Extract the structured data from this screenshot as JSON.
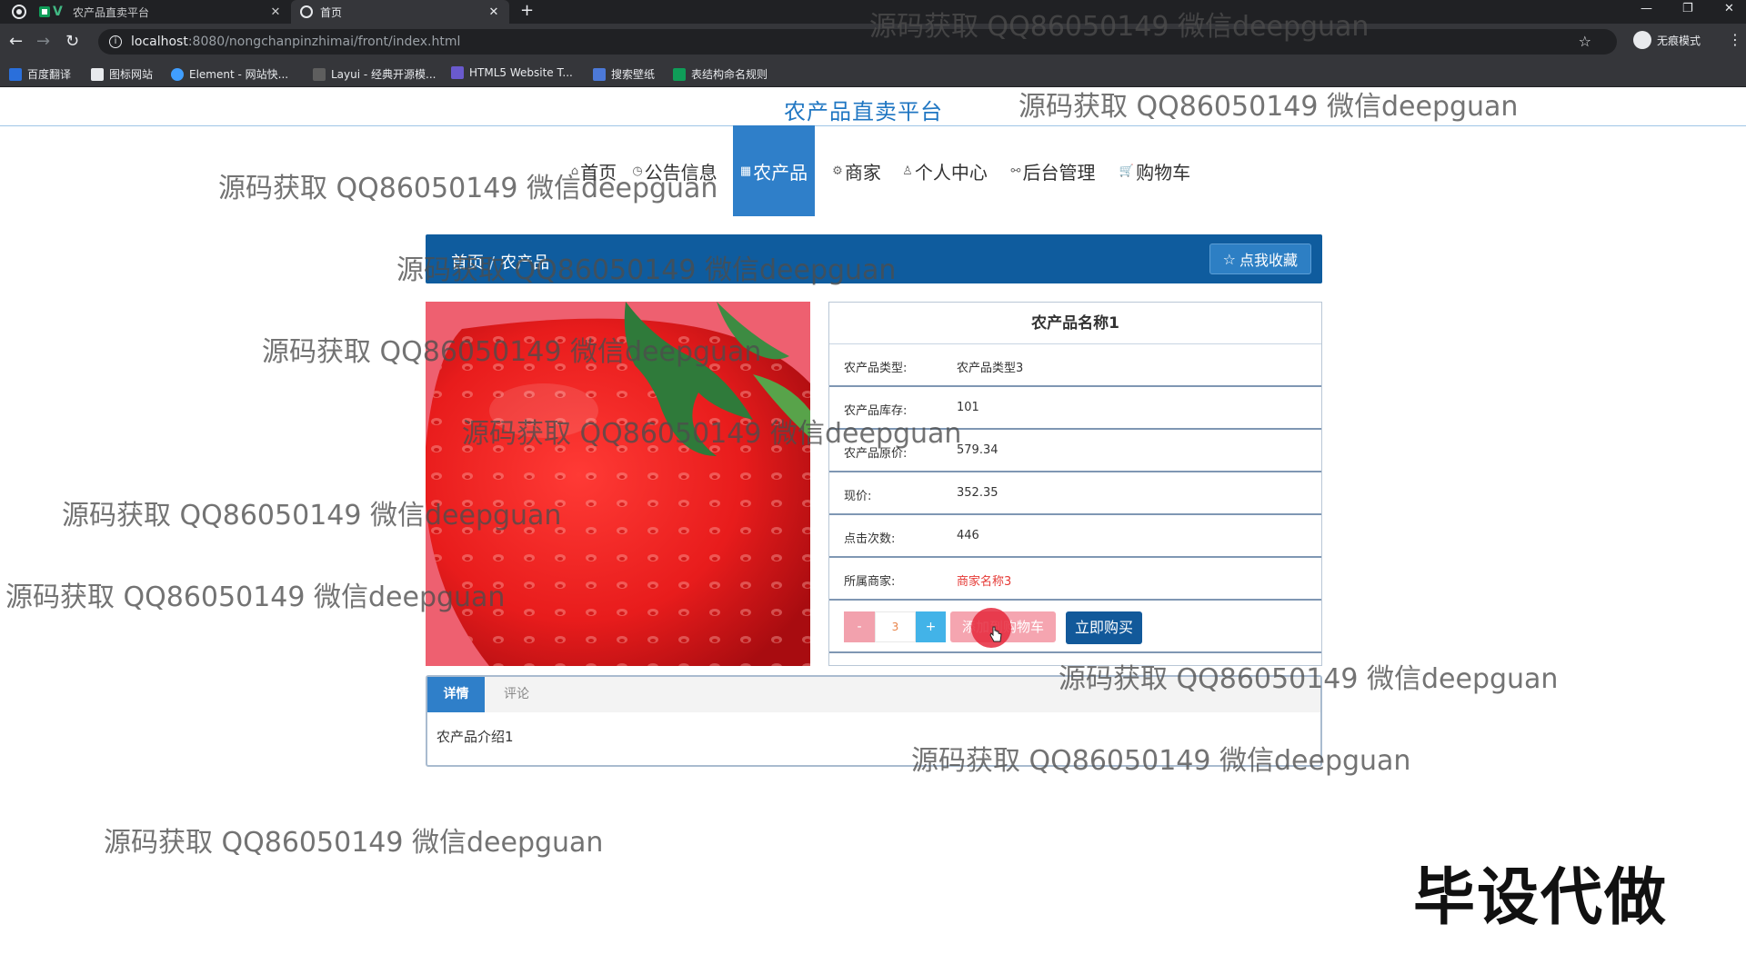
{
  "browser": {
    "tabs": [
      {
        "title": "农产品直卖平台",
        "active": false
      },
      {
        "title": "首页",
        "active": true
      }
    ],
    "url_host": "localhost",
    "url_path": ":8080/nongchanpinzhimai/front/index.html",
    "incognito_label": "无痕模式",
    "bookmarks": [
      "百度翻译",
      "图标网站",
      "Element - 网站快...",
      "Layui - 经典开源模...",
      "HTML5 Website T...",
      "搜索壁纸",
      "表结构命名规则"
    ]
  },
  "site": {
    "title": "农产品直卖平台"
  },
  "nav": {
    "items": [
      {
        "label": "首页",
        "icon": "home-icon",
        "active": false
      },
      {
        "label": "公告信息",
        "icon": "clock-icon",
        "active": false
      },
      {
        "label": "农产品",
        "icon": "grid-icon",
        "active": true
      },
      {
        "label": "商家",
        "icon": "gear-icon",
        "active": false
      },
      {
        "label": "个人中心",
        "icon": "user-icon",
        "active": false
      },
      {
        "label": "后台管理",
        "icon": "link-icon",
        "active": false
      },
      {
        "label": "购物车",
        "icon": "cart-icon",
        "active": false
      }
    ]
  },
  "banner": {
    "crumb_home": "首页",
    "crumb_current": "农产品",
    "favorite_label": "点我收藏"
  },
  "product": {
    "image_alt": "strawberry",
    "name": "农产品名称1",
    "rows": [
      {
        "label": "农产品类型:",
        "value": "农产品类型3"
      },
      {
        "label": "农产品库存:",
        "value": "101"
      },
      {
        "label": "农产品原价:",
        "value": "579.34"
      },
      {
        "label": "现价:",
        "value": "352.35"
      },
      {
        "label": "点击次数:",
        "value": "446"
      },
      {
        "label": "所属商家:",
        "value": "商家名称3"
      }
    ],
    "quantity": "3",
    "minus_label": "-",
    "plus_label": "+",
    "add_cart_label": "添加到购物车",
    "buy_now_label": "立即购买"
  },
  "detail_tabs": {
    "detail_label": "详情",
    "comment_label": "评论",
    "content": "农产品介绍1"
  },
  "overlay": {
    "watermark": "源码获取 QQ86050149 微信deepguan",
    "badge": "毕设代做"
  }
}
